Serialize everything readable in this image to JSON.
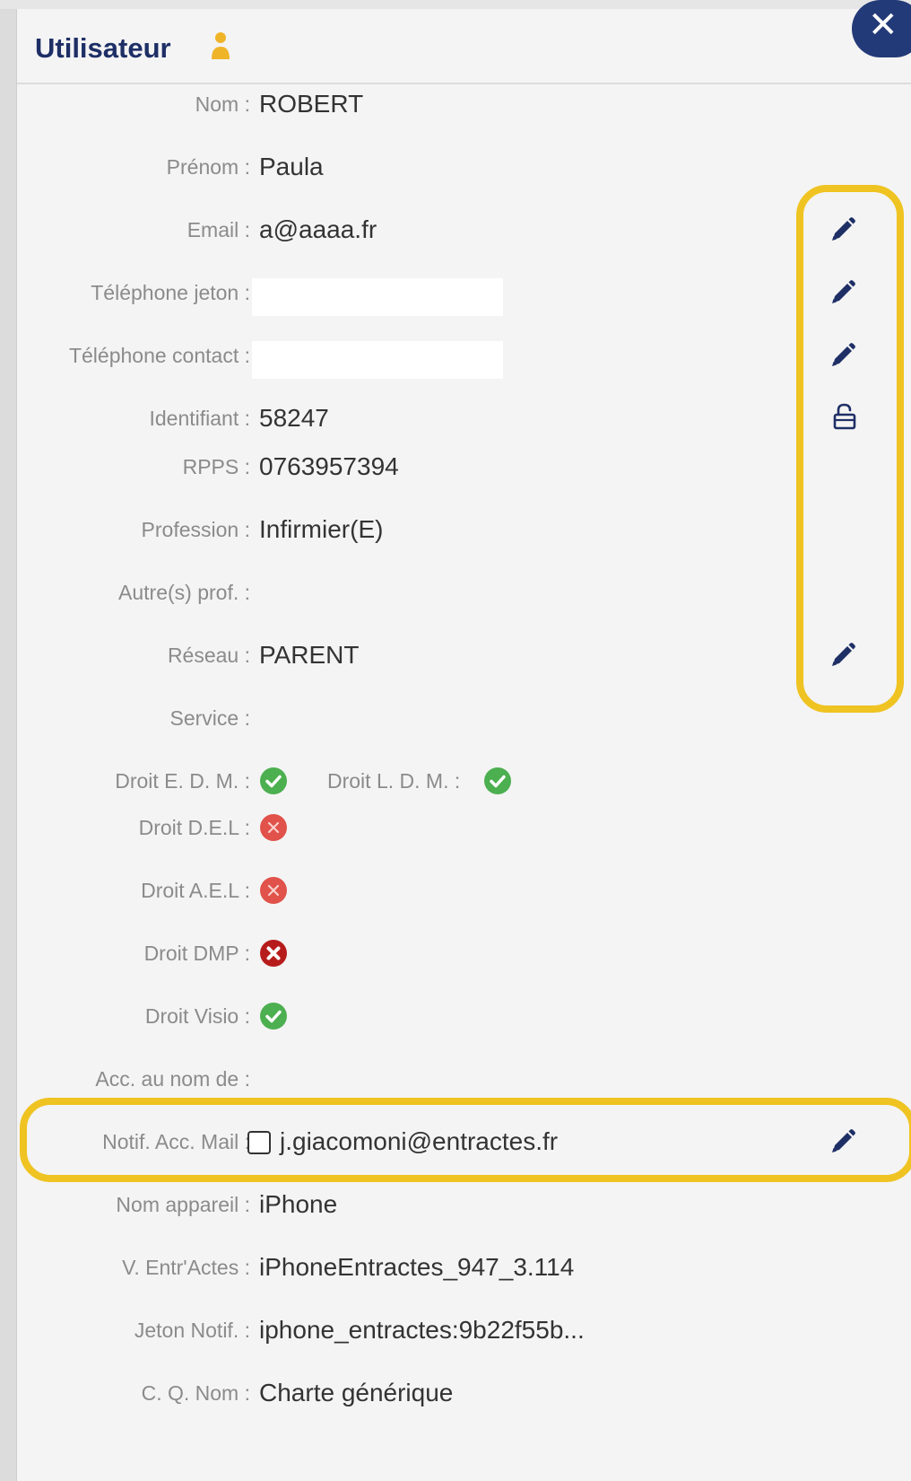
{
  "header": {
    "title": "Utilisateur",
    "close_label": "✕"
  },
  "fields": {
    "nom": {
      "label": "Nom :",
      "value": "ROBERT"
    },
    "prenom": {
      "label": "Prénom :",
      "value": "Paula"
    },
    "email": {
      "label": "Email :",
      "value": "a@aaaa.fr"
    },
    "tel_jeton": {
      "label": "Téléphone jeton :"
    },
    "tel_contact": {
      "label": "Téléphone contact :"
    },
    "identifiant": {
      "label": "Identifiant :",
      "value": "58247"
    },
    "rpps": {
      "label": "RPPS :",
      "value": "0763957394"
    },
    "profession": {
      "label": "Profession :",
      "value": "Infirmier(E)"
    },
    "autres_prof": {
      "label": "Autre(s) prof. :"
    },
    "reseau": {
      "label": "Réseau :",
      "value": "PARENT"
    },
    "service": {
      "label": "Service :"
    },
    "droit_edm": {
      "label": "Droit E. D. M. :",
      "status": "granted"
    },
    "droit_ldm": {
      "label": "Droit L. D. M. :",
      "status": "granted"
    },
    "droit_del": {
      "label": "Droit D.E.L :",
      "status": "denied"
    },
    "droit_ael": {
      "label": "Droit A.E.L :",
      "status": "denied"
    },
    "droit_dmp": {
      "label": "Droit DMP :",
      "status": "denied-strong"
    },
    "droit_visio": {
      "label": "Droit Visio :",
      "status": "granted"
    },
    "acc_nom": {
      "label": "Acc. au nom de :"
    },
    "notif_mail": {
      "label": "Notif. Acc. Mail :",
      "value": "j.giacomoni@entractes.fr",
      "checked": false
    },
    "nom_appareil": {
      "label": "Nom appareil :",
      "value": "iPhone"
    },
    "v_entractes": {
      "label": "V. Entr'Actes :",
      "value": "iPhoneEntractes_947_3.114"
    },
    "jeton_notif": {
      "label": "Jeton Notif. :",
      "value": "iphone_entractes:9b22f55b..."
    },
    "cq_nom": {
      "label": "C. Q. Nom :",
      "value": "Charte générique"
    }
  },
  "colors": {
    "title": "#1e2f66",
    "highlight": "#efc321",
    "granted": "#4caf50",
    "denied": "#e0524a",
    "denied_strong": "#b71c1c",
    "icon": "#1e2f66"
  }
}
